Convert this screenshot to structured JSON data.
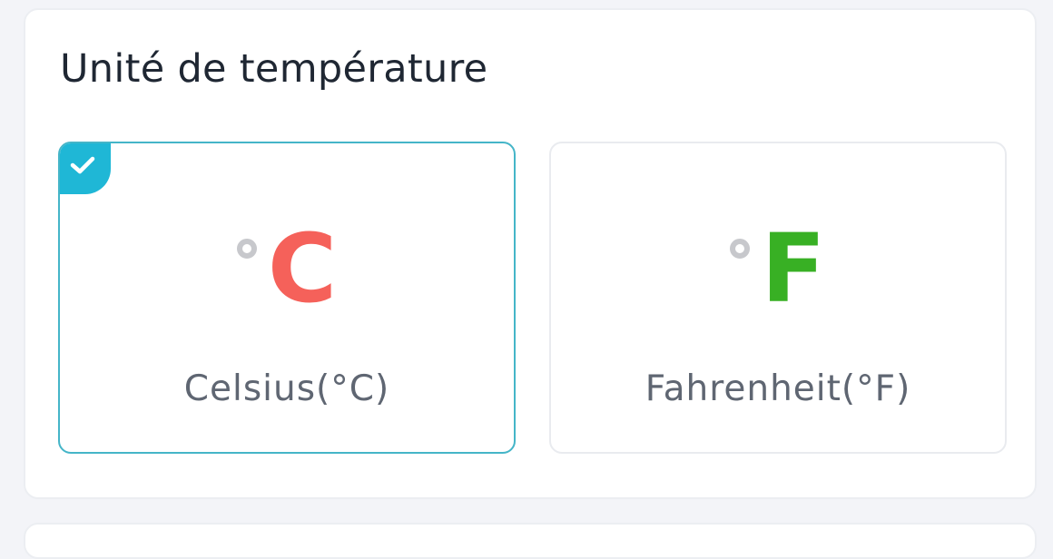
{
  "section": {
    "title": "Unité de température"
  },
  "options": [
    {
      "symbol": "C",
      "label": "Celsius(°C)",
      "color": "#f5615a",
      "selected": true
    },
    {
      "symbol": "F",
      "label": "Fahrenheit(°F)",
      "color": "#38b024",
      "selected": false
    }
  ],
  "icons": {
    "selected_marker": "checkmark-icon",
    "degree": "degree-circle-icon"
  },
  "colors": {
    "accent": "#1fb7d6",
    "selected_border": "#45b5c8",
    "degree": "#c7c8cc",
    "label_text": "#5f6672",
    "title_text": "#1f2733"
  }
}
